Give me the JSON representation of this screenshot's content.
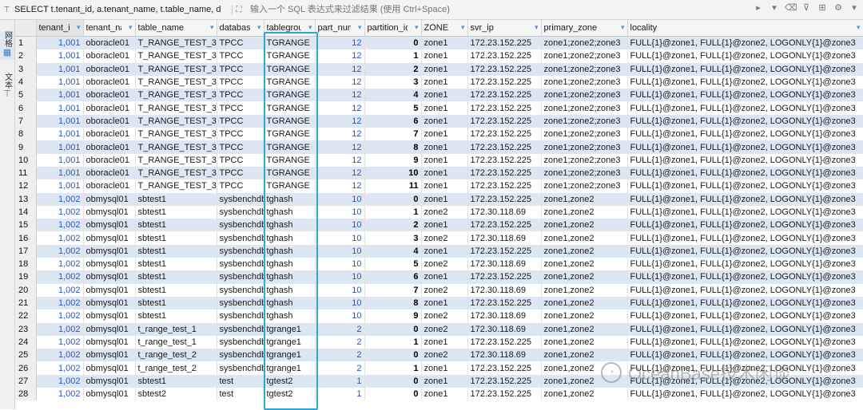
{
  "query_bar": {
    "sql_text": "SELECT t.tenant_id, a.tenant_name, t.table_name, d",
    "filter_placeholder": "输入一个 SQL 表达式来过滤结果 (使用 Ctrl+Space)"
  },
  "side_tabs": [
    {
      "label": "网格",
      "icon": "grid-icon"
    },
    {
      "label": "文本",
      "icon": "text-icon"
    }
  ],
  "columns": [
    "tenant_id",
    "tenant_name",
    "table_name",
    "database_name",
    "tablegroup_name",
    "part_num",
    "partition_id",
    "ZONE",
    "svr_ip",
    "primary_zone",
    "locality"
  ],
  "column_headers": [
    "tenant_id",
    "tenant_name",
    "table_name",
    "database_name",
    "tablegroup",
    "part_num",
    "partition_id",
    "ZONE",
    "svr_ip",
    "primary_zone",
    "locality"
  ],
  "rows": [
    [
      "1",
      "1,001",
      "oboracle01",
      "T_RANGE_TEST_3",
      "TPCC",
      "TGRANGE",
      "12",
      "0",
      "zone1",
      "172.23.152.225",
      "zone1;zone2;zone3",
      "FULL{1}@zone1, FULL{1}@zone2, LOGONLY{1}@zone3"
    ],
    [
      "2",
      "1,001",
      "oboracle01",
      "T_RANGE_TEST_3",
      "TPCC",
      "TGRANGE",
      "12",
      "1",
      "zone1",
      "172.23.152.225",
      "zone1;zone2;zone3",
      "FULL{1}@zone1, FULL{1}@zone2, LOGONLY{1}@zone3"
    ],
    [
      "3",
      "1,001",
      "oboracle01",
      "T_RANGE_TEST_3",
      "TPCC",
      "TGRANGE",
      "12",
      "2",
      "zone1",
      "172.23.152.225",
      "zone1;zone2;zone3",
      "FULL{1}@zone1, FULL{1}@zone2, LOGONLY{1}@zone3"
    ],
    [
      "4",
      "1,001",
      "oboracle01",
      "T_RANGE_TEST_3",
      "TPCC",
      "TGRANGE",
      "12",
      "3",
      "zone1",
      "172.23.152.225",
      "zone1;zone2;zone3",
      "FULL{1}@zone1, FULL{1}@zone2, LOGONLY{1}@zone3"
    ],
    [
      "5",
      "1,001",
      "oboracle01",
      "T_RANGE_TEST_3",
      "TPCC",
      "TGRANGE",
      "12",
      "4",
      "zone1",
      "172.23.152.225",
      "zone1;zone2;zone3",
      "FULL{1}@zone1, FULL{1}@zone2, LOGONLY{1}@zone3"
    ],
    [
      "6",
      "1,001",
      "oboracle01",
      "T_RANGE_TEST_3",
      "TPCC",
      "TGRANGE",
      "12",
      "5",
      "zone1",
      "172.23.152.225",
      "zone1;zone2;zone3",
      "FULL{1}@zone1, FULL{1}@zone2, LOGONLY{1}@zone3"
    ],
    [
      "7",
      "1,001",
      "oboracle01",
      "T_RANGE_TEST_3",
      "TPCC",
      "TGRANGE",
      "12",
      "6",
      "zone1",
      "172.23.152.225",
      "zone1;zone2;zone3",
      "FULL{1}@zone1, FULL{1}@zone2, LOGONLY{1}@zone3"
    ],
    [
      "8",
      "1,001",
      "oboracle01",
      "T_RANGE_TEST_3",
      "TPCC",
      "TGRANGE",
      "12",
      "7",
      "zone1",
      "172.23.152.225",
      "zone1;zone2;zone3",
      "FULL{1}@zone1, FULL{1}@zone2, LOGONLY{1}@zone3"
    ],
    [
      "9",
      "1,001",
      "oboracle01",
      "T_RANGE_TEST_3",
      "TPCC",
      "TGRANGE",
      "12",
      "8",
      "zone1",
      "172.23.152.225",
      "zone1;zone2;zone3",
      "FULL{1}@zone1, FULL{1}@zone2, LOGONLY{1}@zone3"
    ],
    [
      "10",
      "1,001",
      "oboracle01",
      "T_RANGE_TEST_3",
      "TPCC",
      "TGRANGE",
      "12",
      "9",
      "zone1",
      "172.23.152.225",
      "zone1;zone2;zone3",
      "FULL{1}@zone1, FULL{1}@zone2, LOGONLY{1}@zone3"
    ],
    [
      "11",
      "1,001",
      "oboracle01",
      "T_RANGE_TEST_3",
      "TPCC",
      "TGRANGE",
      "12",
      "10",
      "zone1",
      "172.23.152.225",
      "zone1;zone2;zone3",
      "FULL{1}@zone1, FULL{1}@zone2, LOGONLY{1}@zone3"
    ],
    [
      "12",
      "1,001",
      "oboracle01",
      "T_RANGE_TEST_3",
      "TPCC",
      "TGRANGE",
      "12",
      "11",
      "zone1",
      "172.23.152.225",
      "zone1;zone2;zone3",
      "FULL{1}@zone1, FULL{1}@zone2, LOGONLY{1}@zone3"
    ],
    [
      "13",
      "1,002",
      "obmysql01",
      "sbtest1",
      "sysbenchdb",
      "tghash",
      "10",
      "0",
      "zone1",
      "172.23.152.225",
      "zone1,zone2",
      "FULL{1}@zone1, FULL{1}@zone2, LOGONLY{1}@zone3"
    ],
    [
      "14",
      "1,002",
      "obmysql01",
      "sbtest1",
      "sysbenchdb",
      "tghash",
      "10",
      "1",
      "zone2",
      "172.30.118.69",
      "zone1,zone2",
      "FULL{1}@zone1, FULL{1}@zone2, LOGONLY{1}@zone3"
    ],
    [
      "15",
      "1,002",
      "obmysql01",
      "sbtest1",
      "sysbenchdb",
      "tghash",
      "10",
      "2",
      "zone1",
      "172.23.152.225",
      "zone1,zone2",
      "FULL{1}@zone1, FULL{1}@zone2, LOGONLY{1}@zone3"
    ],
    [
      "16",
      "1,002",
      "obmysql01",
      "sbtest1",
      "sysbenchdb",
      "tghash",
      "10",
      "3",
      "zone2",
      "172.30.118.69",
      "zone1,zone2",
      "FULL{1}@zone1, FULL{1}@zone2, LOGONLY{1}@zone3"
    ],
    [
      "17",
      "1,002",
      "obmysql01",
      "sbtest1",
      "sysbenchdb",
      "tghash",
      "10",
      "4",
      "zone1",
      "172.23.152.225",
      "zone1,zone2",
      "FULL{1}@zone1, FULL{1}@zone2, LOGONLY{1}@zone3"
    ],
    [
      "18",
      "1,002",
      "obmysql01",
      "sbtest1",
      "sysbenchdb",
      "tghash",
      "10",
      "5",
      "zone2",
      "172.30.118.69",
      "zone1,zone2",
      "FULL{1}@zone1, FULL{1}@zone2, LOGONLY{1}@zone3"
    ],
    [
      "19",
      "1,002",
      "obmysql01",
      "sbtest1",
      "sysbenchdb",
      "tghash",
      "10",
      "6",
      "zone1",
      "172.23.152.225",
      "zone1,zone2",
      "FULL{1}@zone1, FULL{1}@zone2, LOGONLY{1}@zone3"
    ],
    [
      "20",
      "1,002",
      "obmysql01",
      "sbtest1",
      "sysbenchdb",
      "tghash",
      "10",
      "7",
      "zone2",
      "172.30.118.69",
      "zone1,zone2",
      "FULL{1}@zone1, FULL{1}@zone2, LOGONLY{1}@zone3"
    ],
    [
      "21",
      "1,002",
      "obmysql01",
      "sbtest1",
      "sysbenchdb",
      "tghash",
      "10",
      "8",
      "zone1",
      "172.23.152.225",
      "zone1,zone2",
      "FULL{1}@zone1, FULL{1}@zone2, LOGONLY{1}@zone3"
    ],
    [
      "22",
      "1,002",
      "obmysql01",
      "sbtest1",
      "sysbenchdb",
      "tghash",
      "10",
      "9",
      "zone2",
      "172.30.118.69",
      "zone1,zone2",
      "FULL{1}@zone1, FULL{1}@zone2, LOGONLY{1}@zone3"
    ],
    [
      "23",
      "1,002",
      "obmysql01",
      "t_range_test_1",
      "sysbenchdb",
      "tgrange1",
      "2",
      "0",
      "zone2",
      "172.30.118.69",
      "zone1,zone2",
      "FULL{1}@zone1, FULL{1}@zone2, LOGONLY{1}@zone3"
    ],
    [
      "24",
      "1,002",
      "obmysql01",
      "t_range_test_1",
      "sysbenchdb",
      "tgrange1",
      "2",
      "1",
      "zone1",
      "172.23.152.225",
      "zone1,zone2",
      "FULL{1}@zone1, FULL{1}@zone2, LOGONLY{1}@zone3"
    ],
    [
      "25",
      "1,002",
      "obmysql01",
      "t_range_test_2",
      "sysbenchdb",
      "tgrange1",
      "2",
      "0",
      "zone2",
      "172.30.118.69",
      "zone1,zone2",
      "FULL{1}@zone1, FULL{1}@zone2, LOGONLY{1}@zone3"
    ],
    [
      "26",
      "1,002",
      "obmysql01",
      "t_range_test_2",
      "sysbenchdb",
      "tgrange1",
      "2",
      "1",
      "zone1",
      "172.23.152.225",
      "zone1,zone2",
      "FULL{1}@zone1, FULL{1}@zone2, LOGONLY{1}@zone3"
    ],
    [
      "27",
      "1,002",
      "obmysql01",
      "sbtest1",
      "test",
      "tgtest2",
      "1",
      "0",
      "zone1",
      "172.23.152.225",
      "zone1,zone2",
      "FULL{1}@zone1, FULL{1}@zone2, LOGONLY{1}@zone3"
    ],
    [
      "28",
      "1,002",
      "obmysql01",
      "sbtest2",
      "test",
      "tgtest2",
      "1",
      "0",
      "zone1",
      "172.23.152.225",
      "zone1,zone2",
      "FULL{1}@zone1, FULL{1}@zone2, LOGONLY{1}@zone3"
    ]
  ],
  "watermark": "OceanBase技术闲谈",
  "colors": {
    "row_alt": "#dde7f4",
    "number_blue": "#2b55c8",
    "highlight_box": "#2fa7d4"
  }
}
